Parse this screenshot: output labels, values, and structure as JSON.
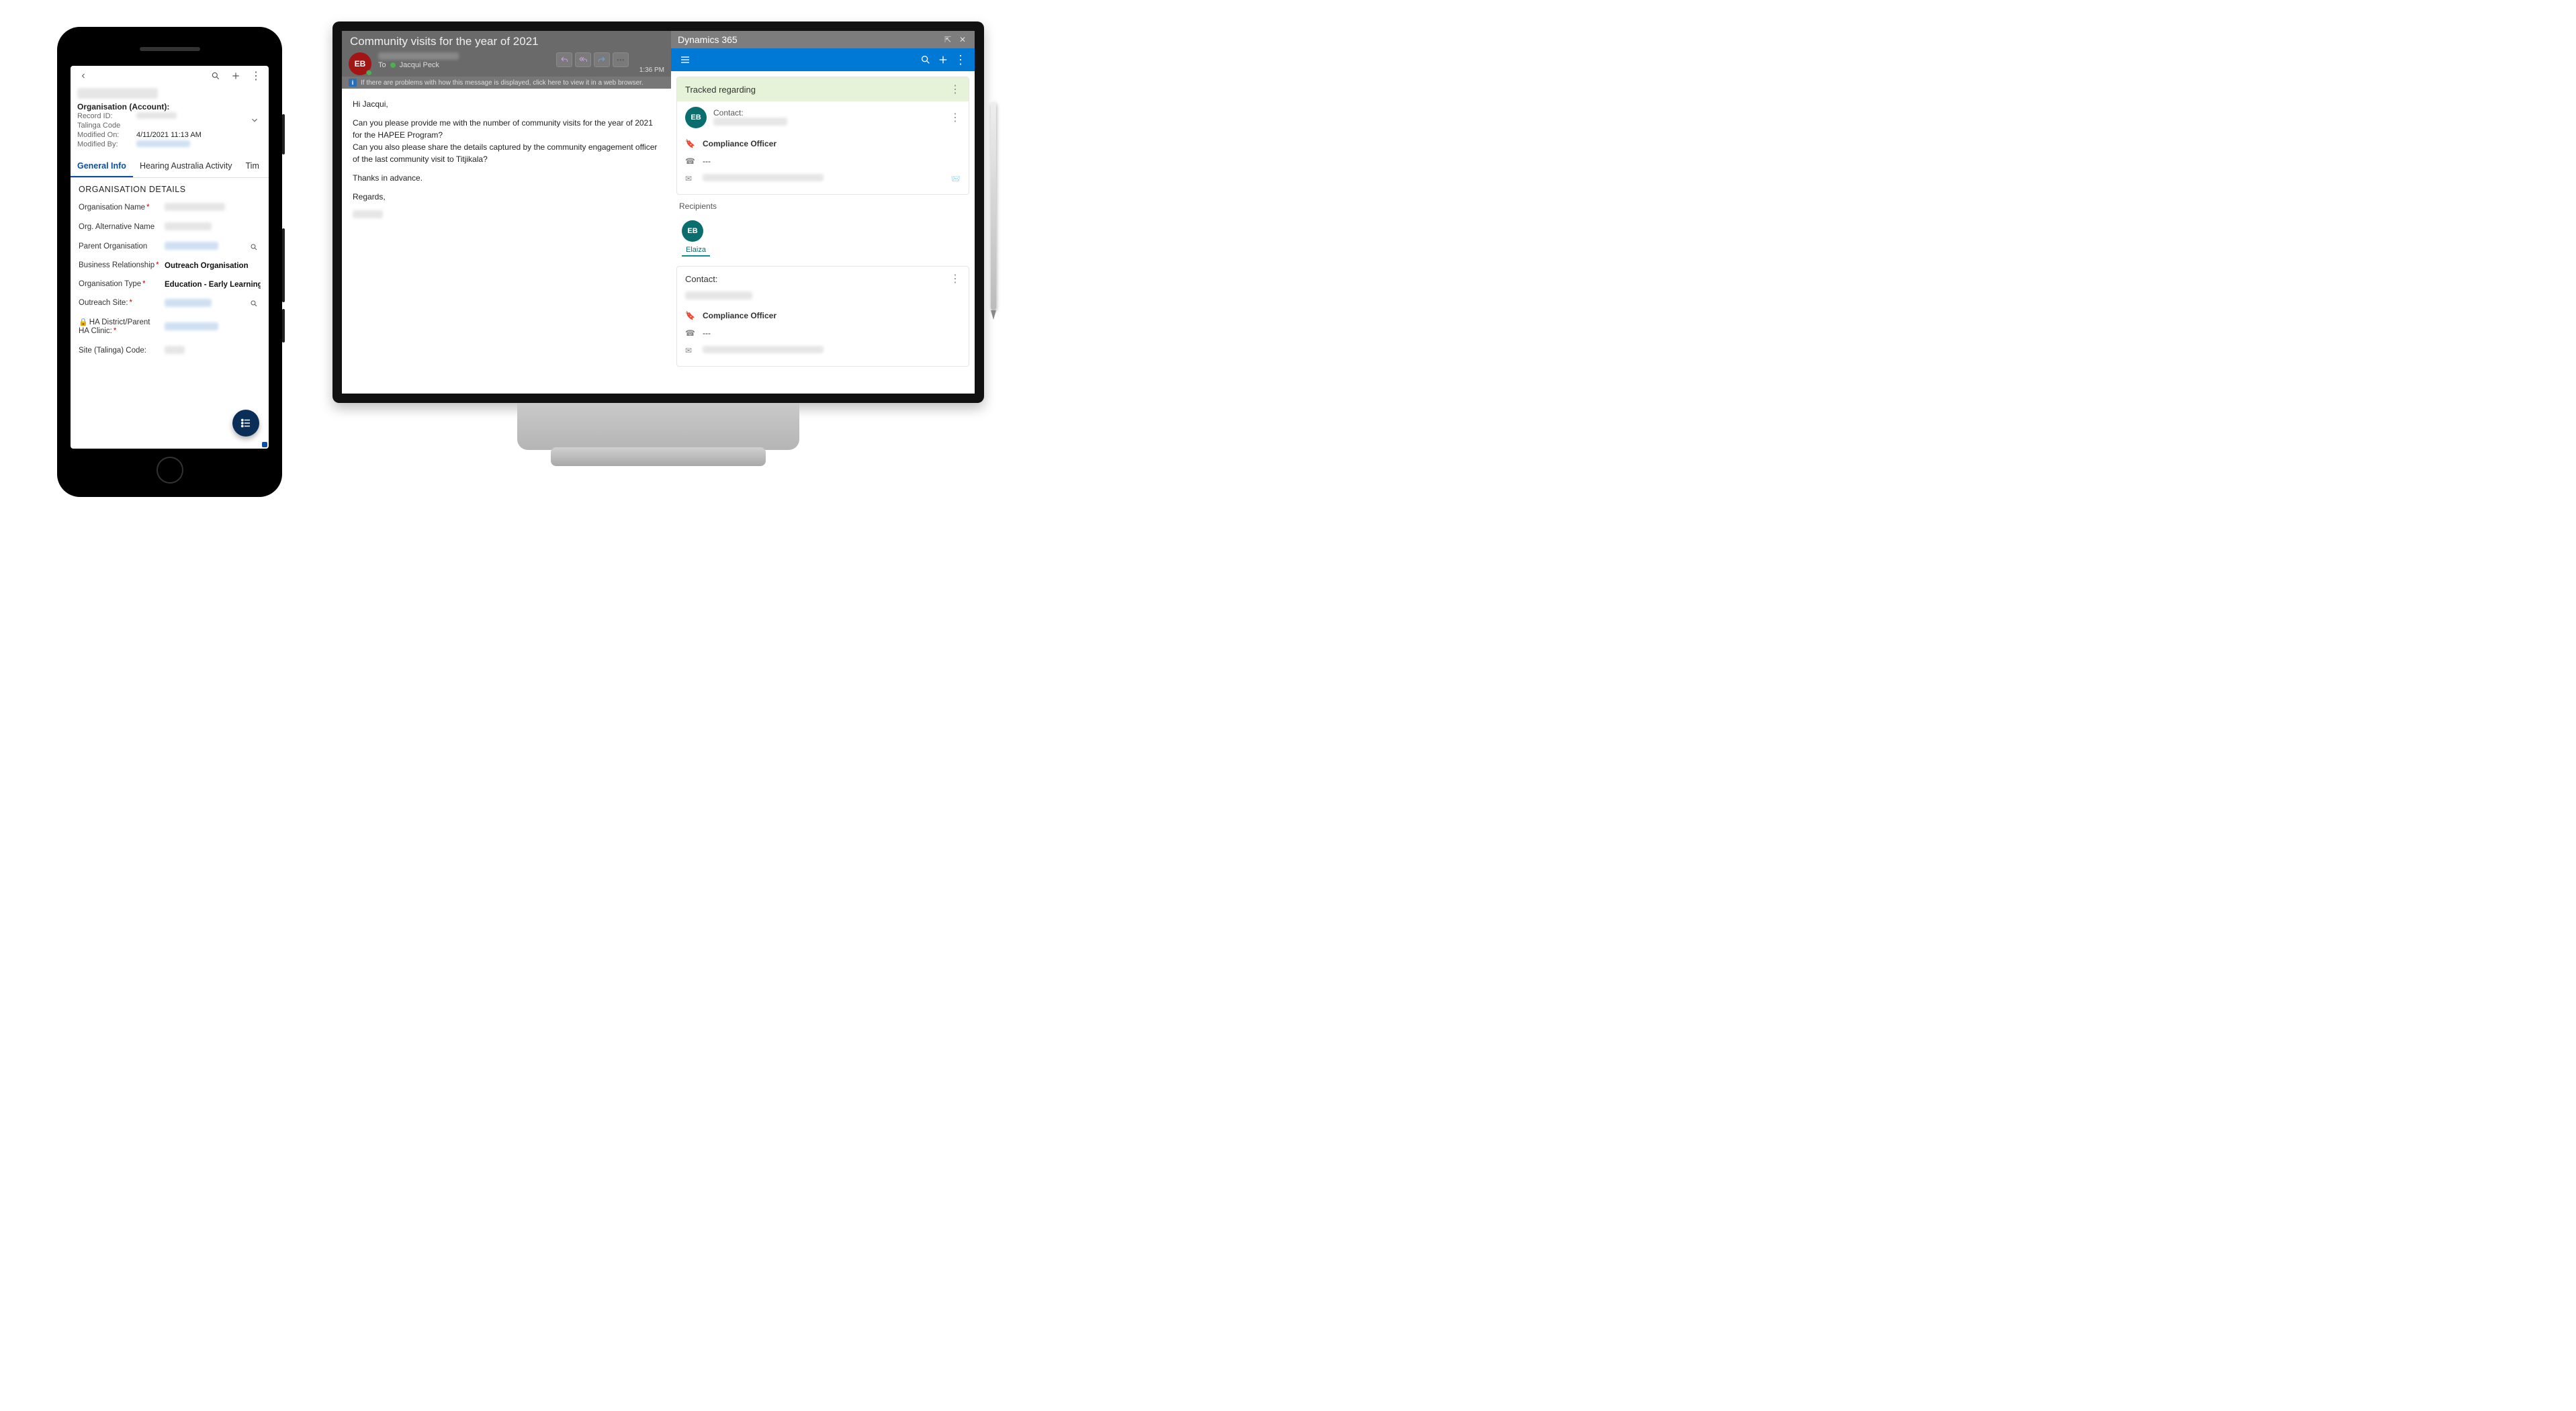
{
  "phone": {
    "header": {
      "title_redacted": "████████",
      "subtitle": "Organisation (Account):",
      "meta": {
        "record_id_label": "Record ID:",
        "record_id_value": "",
        "talinga_label": "Talinga Code",
        "talinga_value": "",
        "modified_on_label": "Modified On:",
        "modified_on_value": "4/11/2021 11:13 AM",
        "modified_by_label": "Modified By:",
        "modified_by_value": ""
      }
    },
    "tabs": [
      "General Info",
      "Hearing Australia Activity",
      "Tim"
    ],
    "section_title": "ORGANISATION DETAILS",
    "fields": {
      "org_name": {
        "label": "Organisation Name",
        "required": true,
        "value": ""
      },
      "alt_name": {
        "label": "Org. Alternative Name",
        "required": false,
        "value": ""
      },
      "parent_org": {
        "label": "Parent Organisation",
        "required": false,
        "value": "",
        "lookup": true
      },
      "biz_rel": {
        "label": "Business Relationship",
        "required": true,
        "value": "Outreach Organisation"
      },
      "org_type": {
        "label": "Organisation Type",
        "required": true,
        "value": "Education - Early Learning"
      },
      "outreach": {
        "label": "Outreach Site:",
        "required": true,
        "value": "",
        "lookup": true
      },
      "ha_clinic": {
        "label": "HA District/Parent HA Clinic:",
        "required": true,
        "value": "",
        "locked": true
      },
      "site_code": {
        "label": "Site (Talinga) Code:",
        "required": false,
        "value": ""
      }
    }
  },
  "outlook": {
    "subject": "Community visits for the year of 2021",
    "sender_initials": "EB",
    "to_label": "To",
    "to_name": "Jacqui Peck",
    "time": "1:36 PM",
    "infobar": "If there are problems with how this message is displayed, click here to view it in a web browser.",
    "body": {
      "greeting": "Hi Jacqui,",
      "p1": "Can you please provide me with the number of community visits for the year of 2021 for the HAPEE Program?",
      "p2": "Can you also please share the details captured by the community engagement officer of the last community visit to Titjikala?",
      "thanks": "Thanks in advance.",
      "regards": "Regards,"
    }
  },
  "d365": {
    "app_title": "Dynamics 365",
    "tracked_heading": "Tracked regarding",
    "contact_label": "Contact:",
    "role": "Compliance Officer",
    "phone_placeholder": "---",
    "recipients_label": "Recipients",
    "recipient_initials": "EB",
    "recipient_name": "Elaiza"
  }
}
